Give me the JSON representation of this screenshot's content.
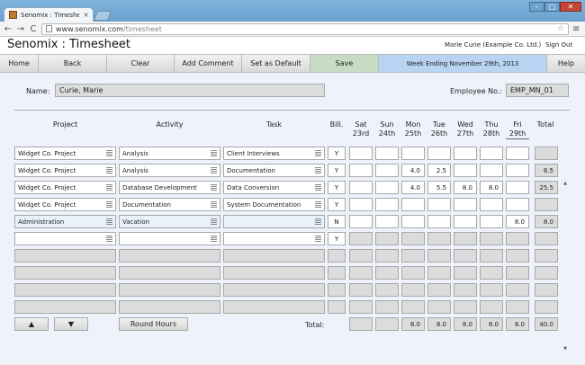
{
  "browser": {
    "tab_title": "Senomix : Timesheet",
    "tab_close": "×",
    "url_host": "www.senomix.com",
    "url_path": "/timesheet",
    "nav_back": "←",
    "nav_forward": "→",
    "reload": "C",
    "star": "☆",
    "menu": "≡",
    "win_min": "–",
    "win_max": "□",
    "win_close": "✕"
  },
  "app": {
    "brand": "Senomix : Timesheet",
    "user": "Marie Curie  (Example Co. Ltd.)",
    "sign_out": "Sign Out"
  },
  "buttons": {
    "home": "Home",
    "back": "Back",
    "clear": "Clear",
    "add_comment": "Add Comment",
    "set_default": "Set as Default",
    "save": "Save",
    "week_ending": "Week Ending November 29th, 2013",
    "help": "Help"
  },
  "form": {
    "name_label": "Name:",
    "name_value": "Curie, Marie",
    "emp_label": "Employee No.:",
    "emp_value": "EMP_MN_01"
  },
  "columns": {
    "project": "Project",
    "activity": "Activity",
    "task": "Task",
    "bill": "Bill.",
    "total": "Total",
    "days": [
      {
        "d": "Sat",
        "n": "23rd"
      },
      {
        "d": "Sun",
        "n": "24th"
      },
      {
        "d": "Mon",
        "n": "25th"
      },
      {
        "d": "Tue",
        "n": "26th"
      },
      {
        "d": "Wed",
        "n": "27th"
      },
      {
        "d": "Thu",
        "n": "28th"
      },
      {
        "d": "Fri",
        "n": "29th"
      }
    ]
  },
  "rows": [
    {
      "project": "Widget Co. Project",
      "activity": "Analysis",
      "task": "Client Interviews",
      "bill": "Y",
      "hours": [
        "",
        "",
        "",
        "",
        "",
        "",
        ""
      ],
      "total": ""
    },
    {
      "project": "Widget Co. Project",
      "activity": "Analysis",
      "task": "Documentation",
      "bill": "Y",
      "hours": [
        "",
        "",
        "4.0",
        "2.5",
        "",
        "",
        ""
      ],
      "total": "6.5"
    },
    {
      "project": "Widget Co. Project",
      "activity": "Database Development",
      "task": "Data Conversion",
      "bill": "Y",
      "hours": [
        "",
        "",
        "4.0",
        "5.5",
        "8.0",
        "8.0",
        ""
      ],
      "total": "25.5"
    },
    {
      "project": "Widget Co. Project",
      "activity": "Documentation",
      "task": "System Documentation",
      "bill": "Y",
      "hours": [
        "",
        "",
        "",
        "",
        "",
        "",
        ""
      ],
      "total": ""
    },
    {
      "project": "Administration",
      "activity": "Vacation",
      "task": "",
      "bill": "N",
      "hours": [
        "",
        "",
        "",
        "",
        "",
        "",
        "8.0"
      ],
      "total": "8.0"
    },
    {
      "project": "",
      "activity": "",
      "task": "",
      "bill": "Y",
      "hours": [
        "",
        "",
        "",
        "",
        "",
        "",
        ""
      ],
      "total": ""
    }
  ],
  "footer": {
    "up": "▲",
    "down": "▼",
    "round_hours": "Round Hours",
    "total_label": "Total:",
    "totals": [
      "",
      "",
      "8.0",
      "8.0",
      "8.0",
      "8.0",
      "8.0"
    ],
    "grand_total": "40.0"
  },
  "colors": {
    "save": "#c7ddc3",
    "week": "#b9d3f3",
    "page": "#eef2fa"
  }
}
